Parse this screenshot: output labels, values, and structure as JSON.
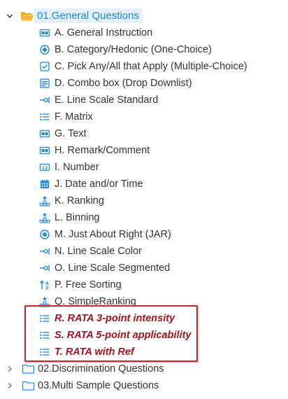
{
  "colors": {
    "accent": "#1e87e4",
    "root_bg": "#e4f1fb",
    "highlight": "#a0151e",
    "highlight_border": "#c8252c",
    "folder_open": "#f0a30a",
    "icon": "#1e87e4"
  },
  "tree": {
    "root": {
      "label": "01.General Questions",
      "expanded": true,
      "icon": "folder-open-icon"
    },
    "items": [
      {
        "label": "A. General Instruction",
        "icon": "text-box-icon"
      },
      {
        "label": "B. Category/Hedonic (One-Choice)",
        "icon": "radio-icon"
      },
      {
        "label": "C. Pick Any/All that Apply (Multiple-Choice)",
        "icon": "checkbox-icon"
      },
      {
        "label": "D. Combo box (Drop Downlist)",
        "icon": "combobox-icon"
      },
      {
        "label": "E. Line Scale Standard",
        "icon": "line-scale-icon"
      },
      {
        "label": "F. Matrix",
        "icon": "list-icon"
      },
      {
        "label": "G. Text",
        "icon": "text-box-icon"
      },
      {
        "label": "H. Remark/Comment",
        "icon": "text-box-icon"
      },
      {
        "label": "I. Number",
        "icon": "number-box-icon"
      },
      {
        "label": "J. Date and/or Time",
        "icon": "calendar-icon"
      },
      {
        "label": "K. Ranking",
        "icon": "ranking-icon"
      },
      {
        "label": "L. Binning",
        "icon": "ranking-icon"
      },
      {
        "label": "M. Just About Right (JAR)",
        "icon": "radio-icon"
      },
      {
        "label": "N. Line Scale Color",
        "icon": "line-scale-icon"
      },
      {
        "label": "O. Line Scale Segmented",
        "icon": "line-scale-icon"
      },
      {
        "label": "P. Free Sorting",
        "icon": "sort-icon"
      },
      {
        "label": "Q. SimpleRanking",
        "icon": "ranking-icon"
      },
      {
        "label": "R. RATA 3-point intensity",
        "icon": "list-icon",
        "highlighted": true
      },
      {
        "label": "S. RATA 5-point applicability",
        "icon": "list-icon",
        "highlighted": true
      },
      {
        "label": "T. RATA with Ref",
        "icon": "list-icon",
        "highlighted": true
      }
    ],
    "categories": [
      {
        "label": "02.Discrimination Questions",
        "expanded": false,
        "icon": "folder-closed-icon"
      },
      {
        "label": "03.Multi Sample Questions",
        "expanded": false,
        "icon": "folder-closed-icon"
      }
    ]
  }
}
